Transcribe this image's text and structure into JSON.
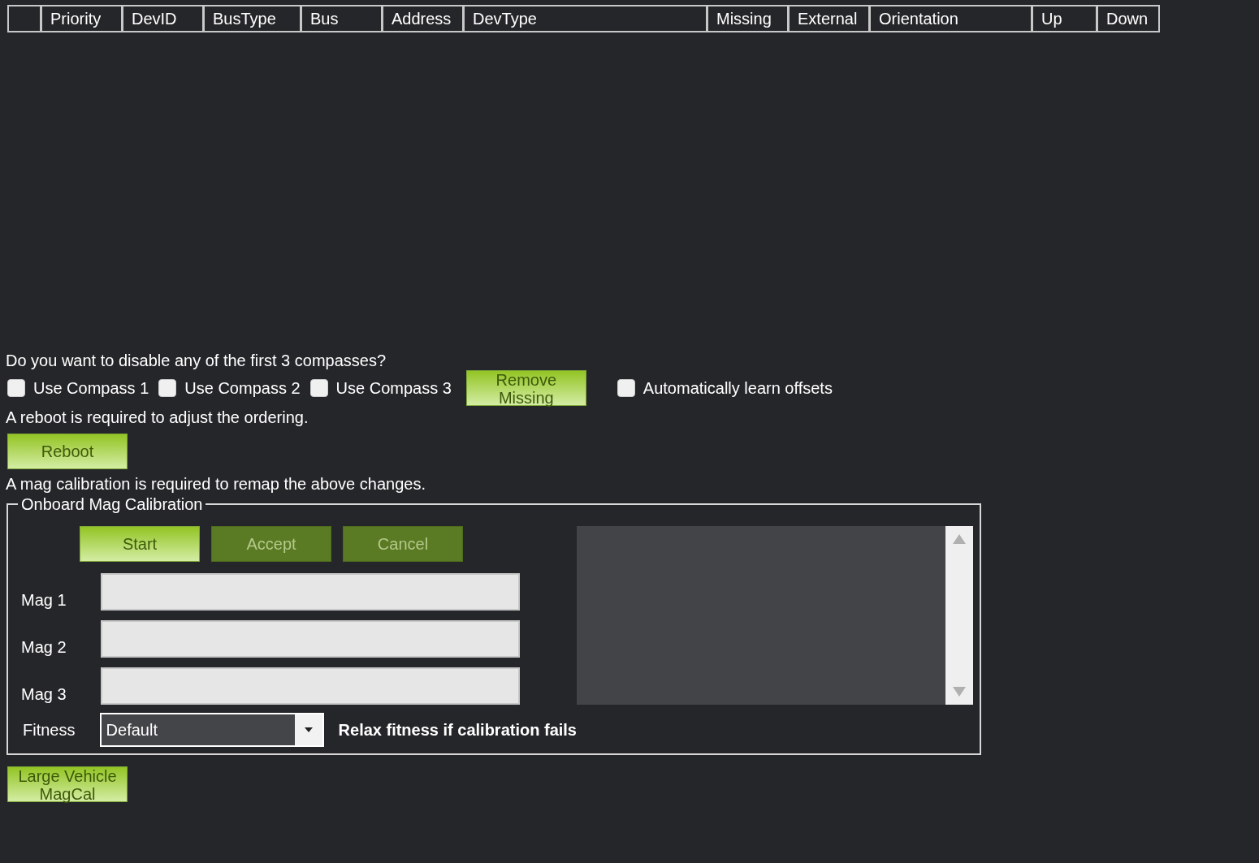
{
  "compass_table": {
    "columns": [
      {
        "label": "Priority"
      },
      {
        "label": "DevID"
      },
      {
        "label": "BusType"
      },
      {
        "label": "Bus"
      },
      {
        "label": "Address"
      },
      {
        "label": "DevType"
      },
      {
        "label": "Missing"
      },
      {
        "label": "External"
      },
      {
        "label": "Orientation"
      },
      {
        "label": "Up"
      },
      {
        "label": "Down"
      }
    ]
  },
  "disable_prompt": "Do you want to disable any of the first 3 compasses?",
  "compass_options": [
    {
      "label": "Use Compass 1",
      "checked": false
    },
    {
      "label": "Use Compass 2",
      "checked": false
    },
    {
      "label": "Use Compass 3",
      "checked": false
    }
  ],
  "remove_missing_button": {
    "label": "Remove Missing",
    "disabled": false
  },
  "auto_learn": {
    "label": "Automatically learn offsets",
    "checked": false
  },
  "reboot_note": "A reboot is required to adjust the ordering.",
  "reboot_button": {
    "label": "Reboot",
    "disabled": false
  },
  "remap_note": "A mag calibration is required to remap the above changes.",
  "onboard_cal": {
    "title": "Onboard Mag Calibration",
    "buttons": [
      {
        "label": "Start",
        "disabled": false
      },
      {
        "label": "Accept",
        "disabled": true
      },
      {
        "label": "Cancel",
        "disabled": true
      }
    ],
    "mags": [
      {
        "label": "Mag 1",
        "level": 0
      },
      {
        "label": "Mag 2",
        "level": 0
      },
      {
        "label": "Mag 3",
        "level": 0
      }
    ],
    "fitness": {
      "label": "Fitness",
      "value": "Default"
    },
    "relax_note": "Relax fitness if calibration fails"
  },
  "large_vehicle_button": {
    "label": "Large Vehicle MagCal",
    "disabled": false
  }
}
